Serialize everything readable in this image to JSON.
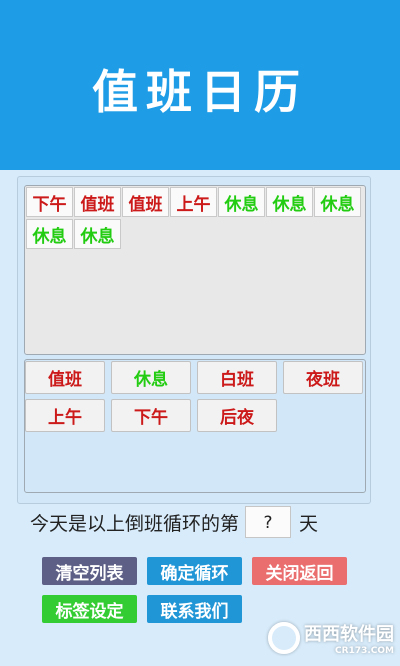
{
  "header": {
    "title": "值班日历"
  },
  "sequence": [
    {
      "label": "下午",
      "color": "#cc1a1a"
    },
    {
      "label": "值班",
      "color": "#cc1a1a"
    },
    {
      "label": "值班",
      "color": "#cc1a1a"
    },
    {
      "label": "上午",
      "color": "#cc1a1a"
    },
    {
      "label": "休息",
      "color": "#22cc11"
    },
    {
      "label": "休息",
      "color": "#22cc11"
    },
    {
      "label": "休息",
      "color": "#22cc11"
    },
    {
      "label": "休息",
      "color": "#22cc11"
    },
    {
      "label": "休息",
      "color": "#22cc11"
    }
  ],
  "palette": [
    {
      "label": "值班",
      "color": "#cc1a1a"
    },
    {
      "label": "休息",
      "color": "#22cc11"
    },
    {
      "label": "白班",
      "color": "#cc1a1a"
    },
    {
      "label": "夜班",
      "color": "#cc1a1a"
    },
    {
      "label": "上午",
      "color": "#cc1a1a"
    },
    {
      "label": "下午",
      "color": "#cc1a1a"
    },
    {
      "label": "后夜",
      "color": "#cc1a1a"
    }
  ],
  "cycle": {
    "prefix": "今天是以上倒班循环的第",
    "value": "?",
    "suffix": "天"
  },
  "actions": {
    "clear": {
      "label": "清空列表",
      "color": "#5d5f86"
    },
    "confirm": {
      "label": "确定循环",
      "color": "#2196d6"
    },
    "close": {
      "label": "关闭返回",
      "color": "#ea6e6e"
    },
    "tags": {
      "label": "标签设定",
      "color": "#33cc33"
    },
    "contact": {
      "label": "联系我们",
      "color": "#2196d6"
    }
  },
  "watermark": {
    "name": "西西软件园",
    "domain": "CR173.COM"
  }
}
